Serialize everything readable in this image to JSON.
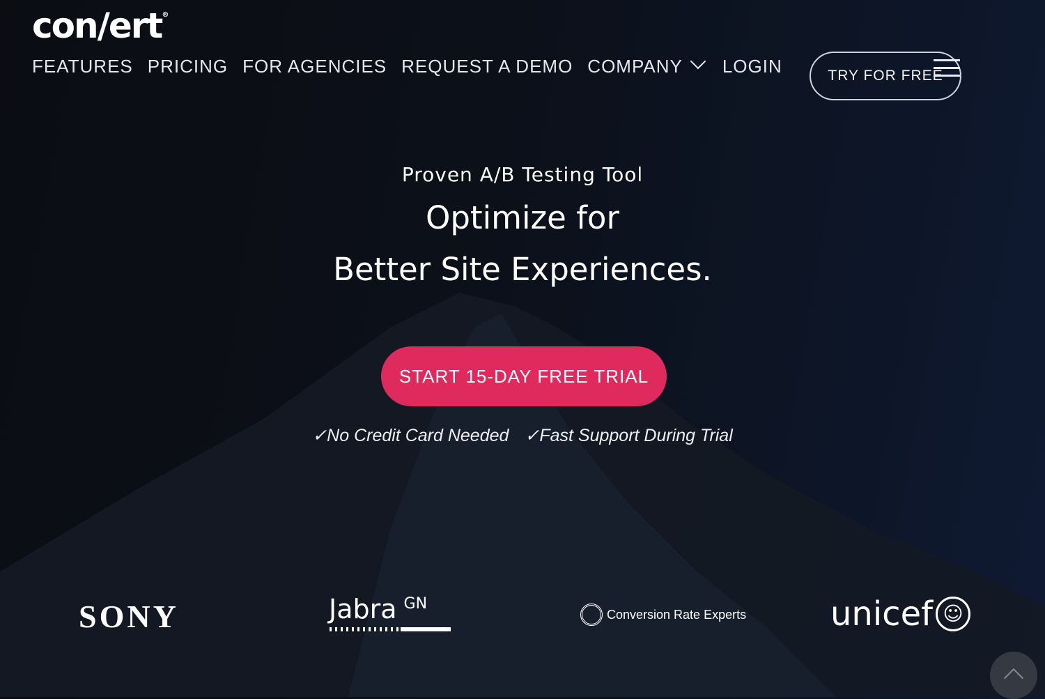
{
  "brand": {
    "logo_text": "con/ert",
    "registered": "®"
  },
  "nav": {
    "items": [
      "FEATURES",
      "PRICING",
      "FOR AGENCIES",
      "REQUEST A DEMO",
      "COMPANY",
      "LOGIN"
    ],
    "try_label": "TRY FOR FREE"
  },
  "hero": {
    "subtitle": "Proven A/B Testing Tool",
    "title_line1": "Optimize for",
    "title_line2": "Better Site Experiences.",
    "cta_label": "START 15-DAY FREE TRIAL",
    "checks": [
      "✓No Credit Card Needed",
      "✓Fast Support During Trial"
    ]
  },
  "clients": {
    "sony": "SONY",
    "jabra": "Jabra",
    "jabra_gn": "GN",
    "cre": "Conversion Rate Experts",
    "unicef": "unicef"
  },
  "colors": {
    "accent": "#de2a5c",
    "background": "#0c1019"
  },
  "icons": {
    "menu": "hamburger-icon",
    "dropdown": "chevron-down-icon",
    "scroll_top": "chevron-up-icon"
  }
}
